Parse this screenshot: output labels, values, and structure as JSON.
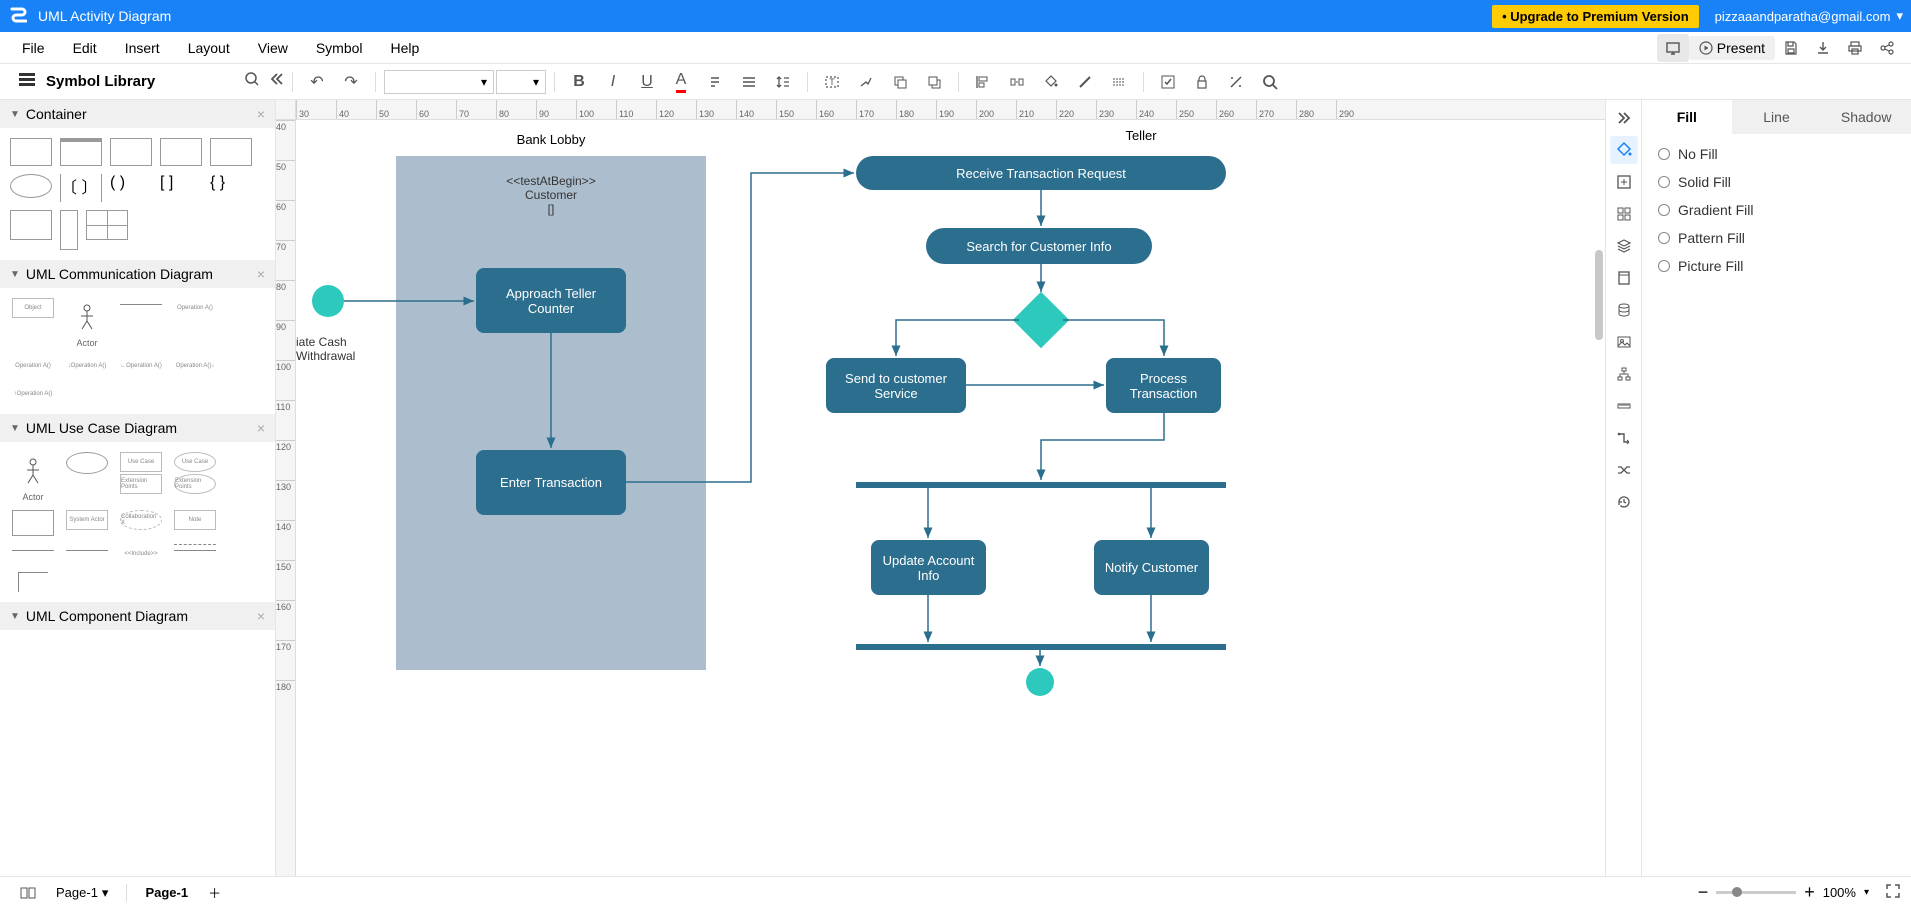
{
  "topbar": {
    "title": "UML Activity Diagram",
    "upgrade": "• Upgrade to Premium Version",
    "user": "pizzaaandparatha@gmail.com"
  },
  "menubar": {
    "items": [
      "File",
      "Edit",
      "Insert",
      "Layout",
      "View",
      "Symbol",
      "Help"
    ],
    "present": "Present"
  },
  "leftbar": {
    "title": "Symbol Library",
    "categories": [
      {
        "name": "Container"
      },
      {
        "name": "UML Communication Diagram"
      },
      {
        "name": "UML Use Case Diagram"
      },
      {
        "name": "UML Component Diagram"
      }
    ],
    "stencil_labels": {
      "actor": "Actor",
      "object": "Object",
      "operation": "Operation A()",
      "usecase": "Use Case",
      "system_actor": "System Actor",
      "extension": "Extension Points",
      "collaboration": "Collaboration X",
      "note": "Note",
      "include": "<<Include>>"
    }
  },
  "rulers": {
    "h": [
      "30",
      "40",
      "50",
      "60",
      "70",
      "80",
      "90",
      "100",
      "110",
      "120",
      "130",
      "140",
      "150",
      "160",
      "170",
      "180",
      "190",
      "200",
      "210",
      "220",
      "230",
      "240",
      "250",
      "260",
      "270",
      "280",
      "290"
    ],
    "v": [
      "40",
      "50",
      "60",
      "70",
      "80",
      "90",
      "100",
      "110",
      "120",
      "130",
      "140",
      "150",
      "160",
      "170",
      "180"
    ]
  },
  "diagram": {
    "lane1_title": "Bank Lobby",
    "lane2_title": "Teller",
    "stereotype": "<<testAtBegin>>",
    "stereotype_sub": "Customer",
    "stereotype_sub2": "[]",
    "clipped_text1": "iate Cash",
    "clipped_text2": "Withdrawal",
    "nodes": {
      "approach": "Approach Teller Counter",
      "enter": "Enter Transaction",
      "receive": "Receive Transaction Request",
      "search": "Search for Customer Info",
      "send_cs": "Send to customer Service",
      "process": "Process Transaction",
      "update": "Update Account Info",
      "notify": "Notify Customer"
    }
  },
  "proppanel": {
    "tabs": [
      "Fill",
      "Line",
      "Shadow"
    ],
    "options": [
      "No Fill",
      "Solid Fill",
      "Gradient Fill",
      "Pattern Fill",
      "Picture Fill"
    ]
  },
  "bottombar": {
    "page_selector": "Page-1",
    "active_page": "Page-1",
    "zoom": "100%"
  },
  "colors": {
    "primary": "#1a82f7",
    "node": "#2c6e8e",
    "accent": "#2dc9bd",
    "lane": "#9db3c6"
  }
}
